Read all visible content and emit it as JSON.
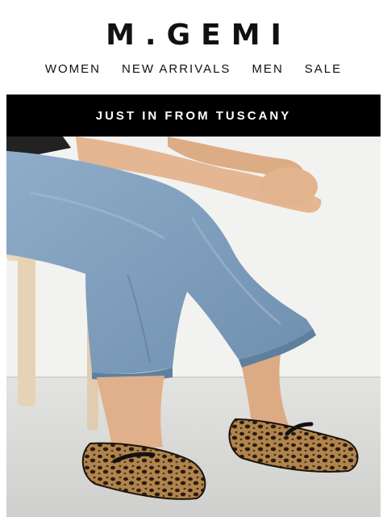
{
  "brand": {
    "logo": "M.GEMI"
  },
  "nav": {
    "items": [
      {
        "label": "WOMEN"
      },
      {
        "label": "NEW ARRIVALS"
      },
      {
        "label": "MEN"
      },
      {
        "label": "SALE"
      }
    ]
  },
  "banner": {
    "text": "JUST IN FROM TUSCANY"
  },
  "hero": {
    "image_subject": "person-in-jeans-wearing-leopard-print-mary-jane-flats",
    "colors": {
      "wall": "#f1f1ef",
      "floor": "#dcdcda",
      "denim": "#7b9cbd",
      "skin": "#e2b48e",
      "stool": "#e8d7bd",
      "leopard": "#a0743f"
    }
  }
}
